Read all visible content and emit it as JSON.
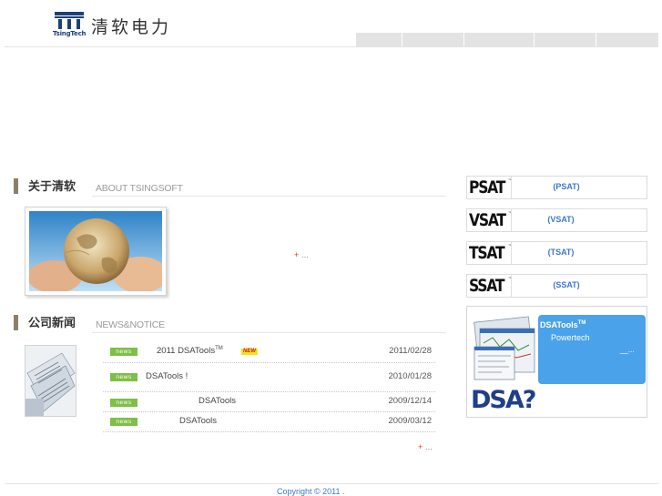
{
  "header": {
    "logo_mark_text": "TsingTech",
    "logo_name": "清软电力",
    "nav_items": [
      "",
      "",
      "",
      "",
      ""
    ]
  },
  "about": {
    "heading_cn": "关于清软",
    "heading_en": "ABOUT TSINGSOFT",
    "more_plus": "+",
    "more_text": "..."
  },
  "news": {
    "heading_cn": "公司新闻",
    "heading_en": "NEWS&NOTICE",
    "badge": "news",
    "new_badge": "NEW",
    "items": [
      {
        "title": "2011 DSATools",
        "tm": "TM",
        "date": "2011/02/28"
      },
      {
        "title": "DSATools          !",
        "date": "2010/01/28"
      },
      {
        "title": "DSATools",
        "date": "2009/12/14"
      },
      {
        "title": "DSATools",
        "date": "2009/03/12"
      }
    ],
    "more_plus": "+",
    "more_text": "..."
  },
  "products": [
    {
      "logo": "PSAT",
      "tm": "™",
      "label": "(PSAT)"
    },
    {
      "logo": "VSAT",
      "tm": "™",
      "label": "(VSAT)"
    },
    {
      "logo": "TSAT",
      "tm": "™",
      "label": "(TSAT)"
    },
    {
      "logo": "SSAT",
      "tm": "™",
      "label": "(SSAT)"
    }
  ],
  "dsa_promo": {
    "title": "DSATools",
    "title_tm": "TM",
    "subtitle": "Powertech",
    "more": "__...",
    "big_text": "DSA?"
  },
  "footer": {
    "copyright": "Copyright © 2011               ."
  },
  "colors": {
    "accent_blue": "#3c78c9",
    "news_badge_green": "#7dbf48",
    "section_bar": "#8c7f6c",
    "promo_blue": "#4aa3ea"
  }
}
